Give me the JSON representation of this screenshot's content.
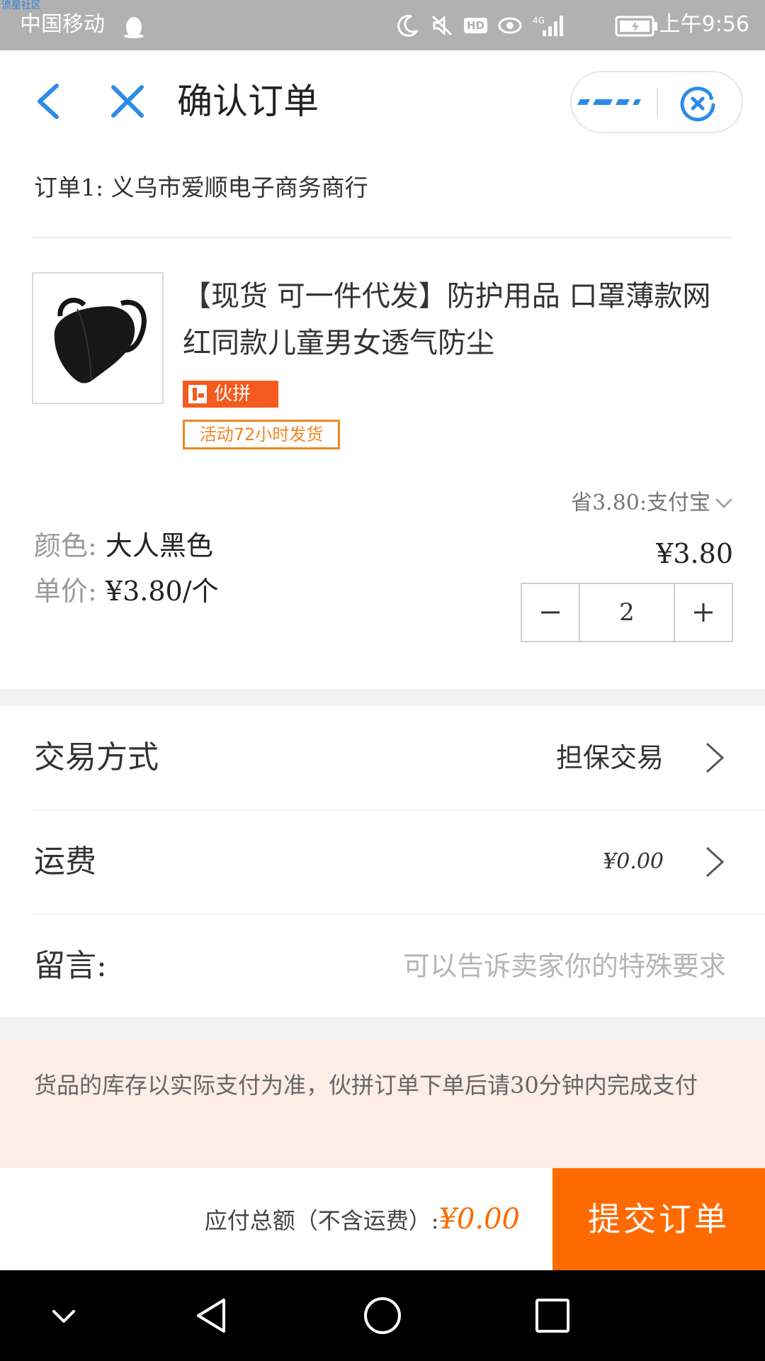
{
  "status_bar": {
    "watermark": "流星社区",
    "carrier": "中国移动",
    "hd": "HD",
    "network": "4G",
    "time": "上午9:56"
  },
  "header": {
    "title": "确认订单",
    "back_icon": "back-arrow-icon",
    "close_icon": "close-icon",
    "more_icon": "more-dots-icon",
    "exit_icon": "miniapp-exit-icon",
    "accent_color": "#2b8ce6"
  },
  "order": {
    "seller": "订单1: 义乌市爱顺电子商务商行",
    "product": {
      "title": "【现货 可一件代发】防护用品 口罩薄款网红同款儿童男女透气防尘",
      "tag_pin": "伙拼",
      "tag_activity": "活动72小时发货"
    },
    "saving": "省3.80:支付宝",
    "color_label": "颜色:",
    "color_value": "大人黑色",
    "unit_price_label": "单价:",
    "unit_price_value": "¥3.80/个",
    "price": "¥3.80",
    "quantity": "2"
  },
  "rows": {
    "trade_label": "交易方式",
    "trade_value": "担保交易",
    "shipping_label": "运费",
    "shipping_value": "¥0.00",
    "message_label": "留言:",
    "message_placeholder": "可以告诉卖家你的特殊要求"
  },
  "notice": "货品的库存以实际支付为准，伙拼订单下单后请30分钟内完成支付",
  "footer": {
    "total_label": "应付总额（不含运费）:",
    "total_value": "¥0.00",
    "submit": "提交订单",
    "accent_color": "#ff6a00"
  }
}
